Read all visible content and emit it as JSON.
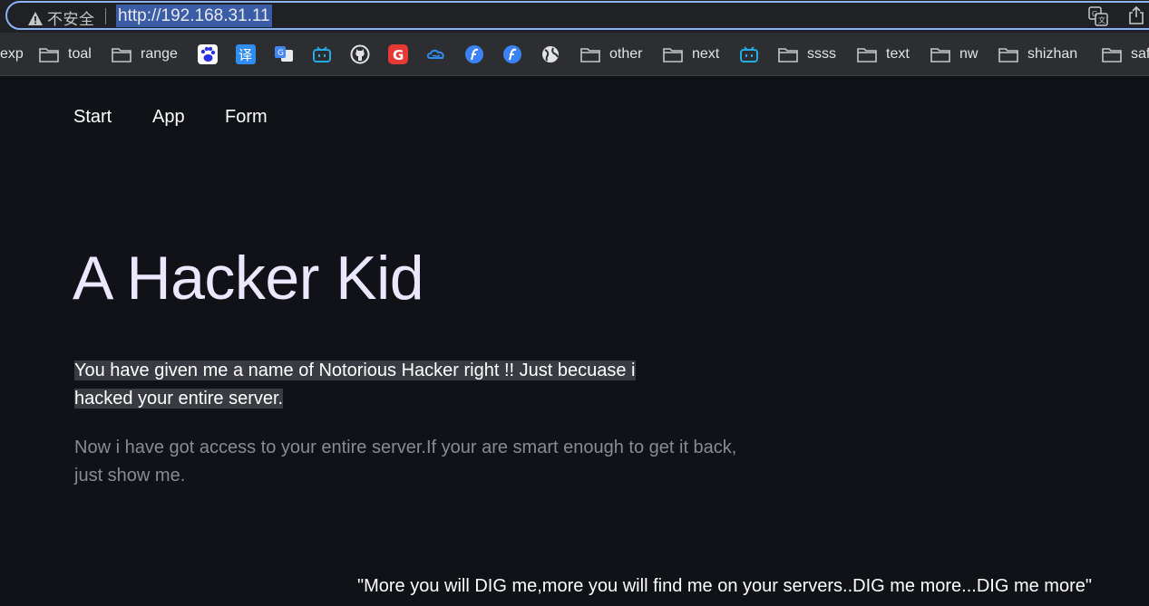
{
  "browser": {
    "security_label": "不安全",
    "url": "http://192.168.31.11"
  },
  "bookmarks": [
    {
      "type": "folder",
      "label": "exp"
    },
    {
      "type": "folder",
      "label": "toal"
    },
    {
      "type": "folder",
      "label": "range"
    },
    {
      "type": "favicon",
      "icon": "baidu-paw-icon"
    },
    {
      "type": "favicon",
      "icon": "translate-yi-icon"
    },
    {
      "type": "favicon",
      "icon": "google-translate-icon"
    },
    {
      "type": "favicon",
      "icon": "bilibili-tv-icon"
    },
    {
      "type": "favicon",
      "icon": "github-icon"
    },
    {
      "type": "favicon",
      "icon": "red-g-icon"
    },
    {
      "type": "favicon",
      "icon": "cloud-icon"
    },
    {
      "type": "favicon",
      "icon": "blue-f-icon"
    },
    {
      "type": "favicon",
      "icon": "blue-f-icon"
    },
    {
      "type": "favicon",
      "icon": "globe-icon"
    },
    {
      "type": "folder",
      "label": "other"
    },
    {
      "type": "folder",
      "label": "next"
    },
    {
      "type": "favicon",
      "icon": "bilibili-tv-icon"
    },
    {
      "type": "folder",
      "label": "ssss"
    },
    {
      "type": "folder",
      "label": "text"
    },
    {
      "type": "folder",
      "label": "nw"
    },
    {
      "type": "folder",
      "label": "shizhan"
    },
    {
      "type": "folder",
      "label": "saf"
    }
  ],
  "nav": {
    "start": "Start",
    "app": "App",
    "form": "Form"
  },
  "hero": {
    "title": "A Hacker Kid",
    "lead": "You have given me a name of Notorious Hacker right !! Just becuase i hacked your entire server.",
    "body": "Now i have got access to your entire server.If your are smart enough to get it back, just show me."
  },
  "footer_quote": "\"More you will DIG me,more you will find me on your servers..DIG me more...DIG me more\"",
  "colors": {
    "page_bg": "#111118",
    "toolbar_bg": "#202124",
    "bookmarks_bg": "#2d2e31",
    "focus_ring": "#8ab4f8",
    "url_selection": "#3b5da8",
    "title_color": "#ebe7ff",
    "muted_text": "#8a8a92"
  }
}
